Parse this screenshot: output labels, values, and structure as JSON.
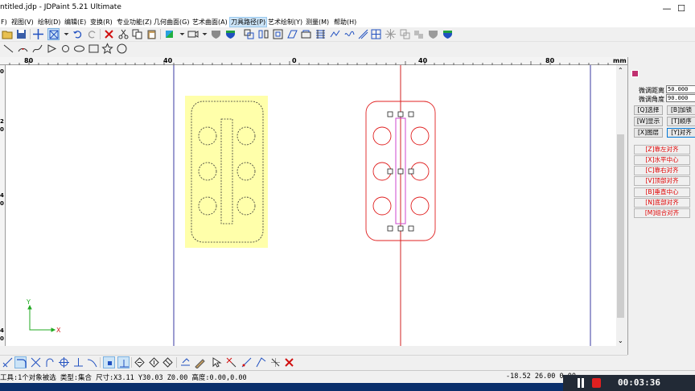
{
  "window": {
    "title": "ntitled.jdp - JDPaint 5.21 Ultimate",
    "minimize": "—",
    "maximize": "☐"
  },
  "menu": [
    {
      "label": "F)"
    },
    {
      "label": "视图(V)"
    },
    {
      "label": "绘制(D)"
    },
    {
      "label": "编辑(E)"
    },
    {
      "label": "变换(R)"
    },
    {
      "label": "专业功能(Z)"
    },
    {
      "label": "几何曲面(G)"
    },
    {
      "label": "艺术曲面(A)"
    },
    {
      "label": "刀具路径(P)"
    },
    {
      "label": "艺术绘制(Y)"
    },
    {
      "label": "测量(M)"
    },
    {
      "label": "帮助(H)"
    }
  ],
  "ruler": {
    "h_labels": [
      "80",
      "40",
      "0",
      "40",
      "80",
      "mm"
    ],
    "v_labels": [
      "0",
      "2",
      "0",
      "4",
      "0",
      "4",
      "0"
    ]
  },
  "panel": {
    "fine_distance_label": "微调距离",
    "fine_distance_value": "50.000",
    "fine_angle_label": "微调角度",
    "fine_angle_value": "90.000",
    "buttons": [
      {
        "label": "[Q]选择"
      },
      {
        "label": "[B]加锁"
      },
      {
        "label": "[W]显示"
      },
      {
        "label": "[T]顺序"
      },
      {
        "label": "[X]图层"
      },
      {
        "label": "[Y]对齐"
      }
    ],
    "align_buttons": [
      {
        "label": "[Z]靠左对齐"
      },
      {
        "label": "[X]水平中心"
      },
      {
        "label": "[C]靠右对齐"
      },
      {
        "label": "[V]顶部对齐"
      },
      {
        "label": "[B]垂直中心"
      },
      {
        "label": "[N]底部对齐"
      },
      {
        "label": "[M]组合对齐"
      }
    ]
  },
  "canvas": {
    "axis_x_label": "X",
    "axis_y_label": "Y"
  },
  "status": {
    "text": "工具:1个对象被选 类型:集合 尺寸:X3.11 Y30.03 Z0.00 高度:0.00,0.00",
    "coords": "-18.52 26.00 0.00"
  },
  "recorder": {
    "time": "00:03:36"
  },
  "colors": {
    "selection_fill": "#ffffaa",
    "red_path": "#e02020",
    "magenta_path": "#cc44cc",
    "guide_blue": "#3a3aa0",
    "guide_red": "#d02020",
    "axis_green": "#22aa22",
    "align_text": "#e00000"
  }
}
